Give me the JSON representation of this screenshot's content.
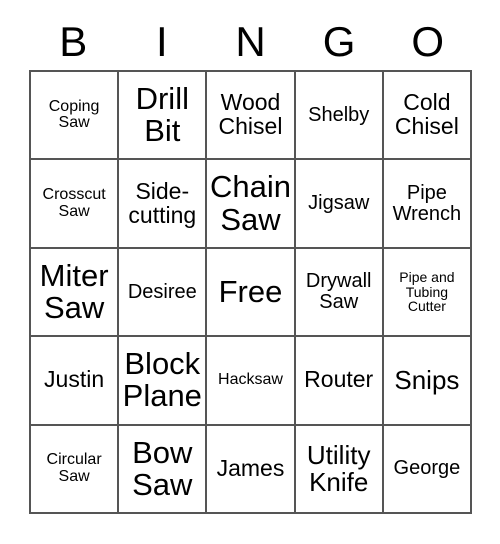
{
  "card": {
    "title": "BINGO",
    "header": [
      "B",
      "I",
      "N",
      "G",
      "O"
    ],
    "free_space_label": "Free",
    "colors": {
      "background": "#ffffff",
      "grid_line": "#555555",
      "text": "#000000"
    },
    "rows": [
      [
        {
          "label": "Coping Saw",
          "size": "sm"
        },
        {
          "label": "Drill Bit",
          "size": "xxl"
        },
        {
          "label": "Wood Chisel",
          "size": "lg"
        },
        {
          "label": "Shelby",
          "size": "md"
        },
        {
          "label": "Cold Chisel",
          "size": "lg"
        }
      ],
      [
        {
          "label": "Crosscut Saw",
          "size": "sm"
        },
        {
          "label": "Side-cutting",
          "size": "lg"
        },
        {
          "label": "Chain Saw",
          "size": "xxl"
        },
        {
          "label": "Jigsaw",
          "size": "md"
        },
        {
          "label": "Pipe Wrench",
          "size": "md"
        }
      ],
      [
        {
          "label": "Miter Saw",
          "size": "xxl"
        },
        {
          "label": "Desiree",
          "size": "md"
        },
        {
          "label": "Free",
          "size": "xxl"
        },
        {
          "label": "Drywall Saw",
          "size": "md"
        },
        {
          "label": "Pipe and Tubing Cutter",
          "size": "xs"
        }
      ],
      [
        {
          "label": "Justin",
          "size": "lg"
        },
        {
          "label": "Block Plane",
          "size": "xxl"
        },
        {
          "label": "Hacksaw",
          "size": "sm"
        },
        {
          "label": "Router",
          "size": "lg"
        },
        {
          "label": "Snips",
          "size": "xl"
        }
      ],
      [
        {
          "label": "Circular Saw",
          "size": "sm"
        },
        {
          "label": "Bow Saw",
          "size": "xxl"
        },
        {
          "label": "James",
          "size": "lg"
        },
        {
          "label": "Utility Knife",
          "size": "xl"
        },
        {
          "label": "George",
          "size": "md"
        }
      ]
    ]
  }
}
